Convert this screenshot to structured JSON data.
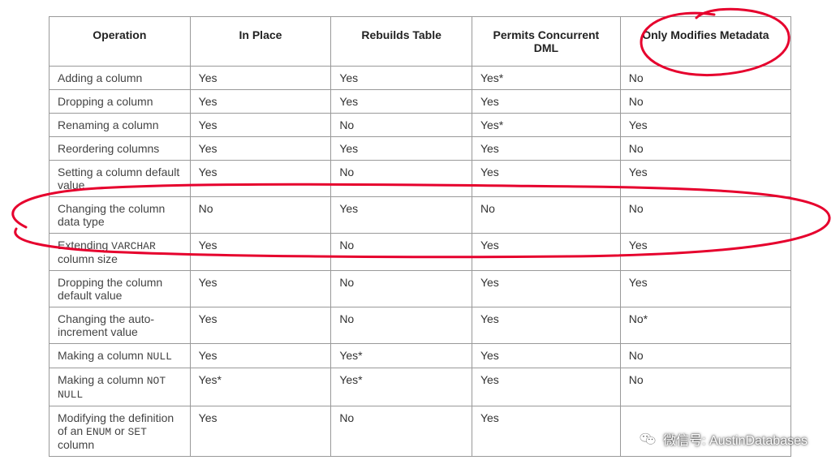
{
  "headers": [
    "Operation",
    "In Place",
    "Rebuilds Table",
    "Permits Concurrent DML",
    "Only Modifies Metadata"
  ],
  "rows": [
    {
      "op_parts": [
        {
          "t": "Adding a column"
        }
      ],
      "in_place": "Yes",
      "rebuilds": "Yes",
      "concurrent": "Yes*",
      "metadata": "No"
    },
    {
      "op_parts": [
        {
          "t": "Dropping a column"
        }
      ],
      "in_place": "Yes",
      "rebuilds": "Yes",
      "concurrent": "Yes",
      "metadata": "No"
    },
    {
      "op_parts": [
        {
          "t": "Renaming a column"
        }
      ],
      "in_place": "Yes",
      "rebuilds": "No",
      "concurrent": "Yes*",
      "metadata": "Yes"
    },
    {
      "op_parts": [
        {
          "t": "Reordering columns"
        }
      ],
      "in_place": "Yes",
      "rebuilds": "Yes",
      "concurrent": "Yes",
      "metadata": "No"
    },
    {
      "op_parts": [
        {
          "t": "Setting a column default value"
        }
      ],
      "in_place": "Yes",
      "rebuilds": "No",
      "concurrent": "Yes",
      "metadata": "Yes"
    },
    {
      "op_parts": [
        {
          "t": "Changing the column data type"
        }
      ],
      "in_place": "No",
      "rebuilds": "Yes",
      "concurrent": "No",
      "metadata": "No"
    },
    {
      "op_parts": [
        {
          "t": "Extending "
        },
        {
          "t": "VARCHAR",
          "code": true
        },
        {
          "t": " column size"
        }
      ],
      "in_place": "Yes",
      "rebuilds": "No",
      "concurrent": "Yes",
      "metadata": "Yes"
    },
    {
      "op_parts": [
        {
          "t": "Dropping the column default value"
        }
      ],
      "in_place": "Yes",
      "rebuilds": "No",
      "concurrent": "Yes",
      "metadata": "Yes"
    },
    {
      "op_parts": [
        {
          "t": "Changing the auto-increment value"
        }
      ],
      "in_place": "Yes",
      "rebuilds": "No",
      "concurrent": "Yes",
      "metadata": "No*"
    },
    {
      "op_parts": [
        {
          "t": "Making a column "
        },
        {
          "t": "NULL",
          "code": true
        }
      ],
      "in_place": "Yes",
      "rebuilds": "Yes*",
      "concurrent": "Yes",
      "metadata": "No"
    },
    {
      "op_parts": [
        {
          "t": "Making a column "
        },
        {
          "t": "NOT NULL",
          "code": true
        }
      ],
      "in_place": "Yes*",
      "rebuilds": "Yes*",
      "concurrent": "Yes",
      "metadata": "No"
    },
    {
      "op_parts": [
        {
          "t": "Modifying the definition of an "
        },
        {
          "t": "ENUM",
          "code": true
        },
        {
          "t": " or "
        },
        {
          "t": "SET",
          "code": true
        },
        {
          "t": " column"
        }
      ],
      "in_place": "Yes",
      "rebuilds": "No",
      "concurrent": "Yes",
      "metadata": ""
    }
  ],
  "watermark": {
    "label": "微信号: AustinDatabases"
  },
  "annotation_color": "#e6002d"
}
